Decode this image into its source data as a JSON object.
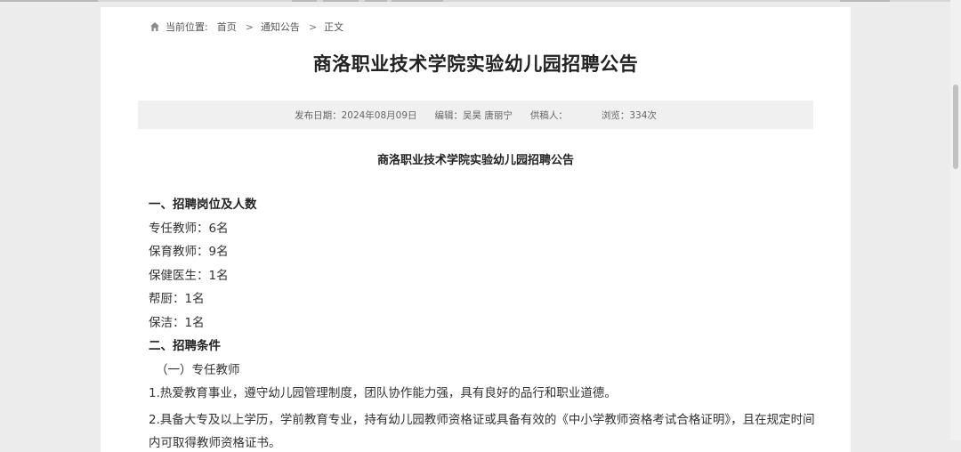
{
  "breadcrumb": {
    "label": "当前位置:",
    "home": "首页",
    "section": "通知公告",
    "current": "正文",
    "separator": ">"
  },
  "page_title": "商洛职业技术学院实验幼儿园招聘公告",
  "meta": {
    "publish_date": "发布日期：2024年08月09日",
    "editor": "编辑：吴昊 唐丽宁",
    "contributor": "供稿人：",
    "views": "浏览：334次"
  },
  "article": {
    "title": "商洛职业技术学院实验幼儿园招聘公告",
    "section1_heading": "一、招聘岗位及人数",
    "positions": [
      "专任教师：6名",
      "保育教师：9名",
      "保健医生：1名",
      "帮厨：1名",
      "保洁：1名"
    ],
    "section2_heading": "二、招聘条件",
    "subsection1": "（一）专任教师",
    "conditions": [
      "1.热爱教育事业，遵守幼儿园管理制度，团队协作能力强，具有良好的品行和职业道德。",
      "2.具备大专及以上学历，学前教育专业，持有幼儿园教师资格证或具备有效的《中小学教师资格考试合格证明》，且在规定时间内可取得教师资格证书。"
    ]
  },
  "icons": {
    "home": "home-icon"
  }
}
